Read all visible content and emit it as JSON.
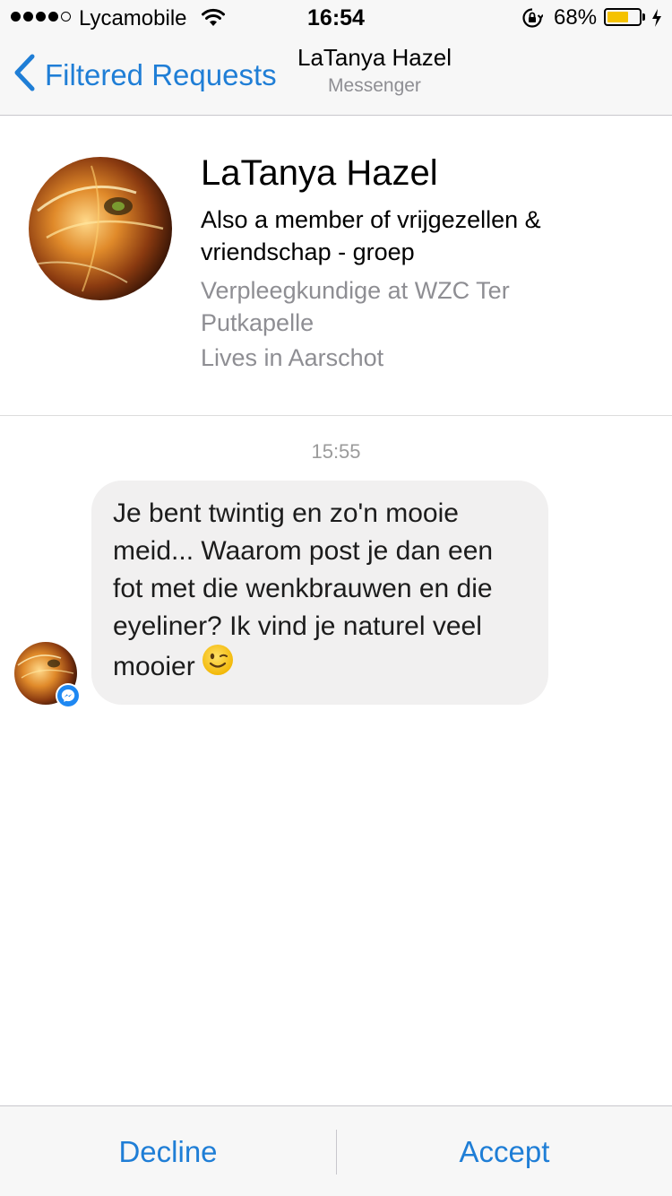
{
  "status_bar": {
    "carrier": "Lycamobile",
    "time": "16:54",
    "battery_percent": "68%",
    "battery_level": 0.68,
    "signal_bars_filled": 4,
    "signal_bars_total": 5,
    "icons": [
      "wifi-icon",
      "rotation-lock-icon",
      "battery-icon",
      "charging-icon"
    ]
  },
  "nav": {
    "back_label": "Filtered Requests",
    "title": "LaTanya Hazel",
    "subtitle": "Messenger"
  },
  "profile": {
    "name": "LaTanya Hazel",
    "mutual": "Also a member of vrijgezellen & vriendschap - groep",
    "work": "Verpleegkundige at WZC Ter Putkapelle",
    "home": "Lives in Aarschot"
  },
  "conversation": {
    "timestamp": "15:55",
    "messages": [
      {
        "text": "Je bent twintig en zo'n mooie meid... Waarom post je dan een fot met die wenkbrauwen en die eyeliner? Ik vind je naturel veel mooier",
        "emoji": "winking-face-emoji"
      }
    ]
  },
  "actions": {
    "decline_label": "Decline",
    "accept_label": "Accept"
  },
  "colors": {
    "accent": "#1f7ed6",
    "bubble": "#f1f0f0",
    "secondary_text": "#8e8e93",
    "battery": "#f5c200"
  }
}
